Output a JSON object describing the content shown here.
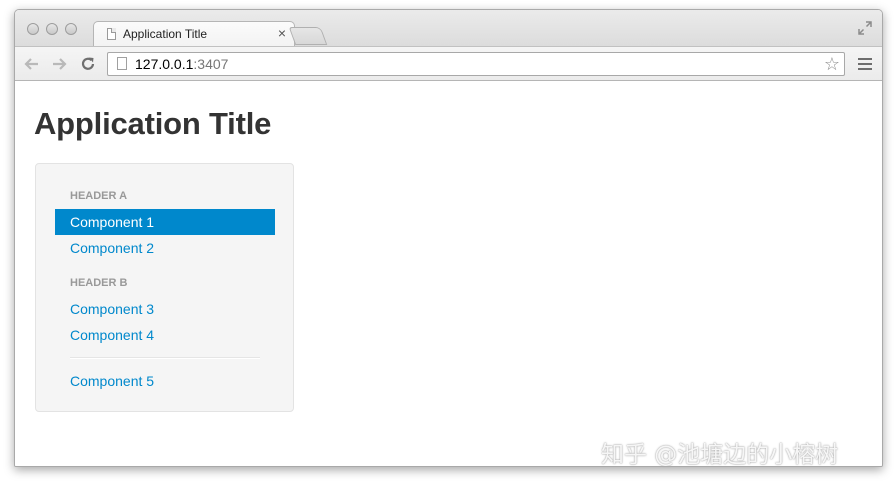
{
  "browser": {
    "tab_title": "Application Title",
    "tab_close": "×",
    "url_host": "127.0.0.1",
    "url_port": ":3407",
    "icons": [
      "document-icon",
      "back-arrow-icon",
      "forward-arrow-icon",
      "reload-icon",
      "star-icon",
      "menu-icon",
      "fullscreen-icon"
    ]
  },
  "page": {
    "title": "Application Title",
    "nav": {
      "header_a": "HEADER A",
      "header_b": "HEADER B",
      "items": [
        {
          "label": "Component 1",
          "active": true
        },
        {
          "label": "Component 2",
          "active": false
        },
        {
          "label": "Component 3",
          "active": false
        },
        {
          "label": "Component 4",
          "active": false
        },
        {
          "label": "Component 5",
          "active": false
        }
      ]
    }
  },
  "watermark": "知乎 @池塘边的小榕树",
  "colors": {
    "accent": "#0088cc",
    "title_text": "#333333",
    "header_text": "#999999",
    "well_bg": "#f5f5f5"
  }
}
